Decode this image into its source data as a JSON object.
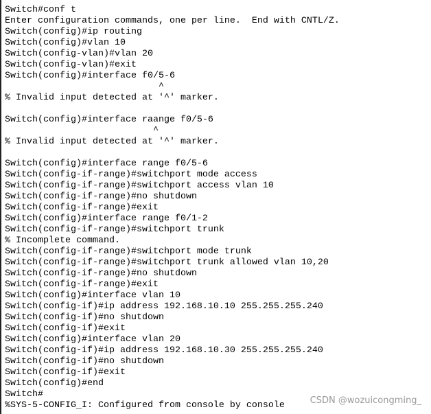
{
  "terminal": {
    "lines": [
      "Switch#conf t",
      "Enter configuration commands, one per line.  End with CNTL/Z.",
      "Switch(config)#ip routing",
      "Switch(config)#vlan 10",
      "Switch(config-vlan)#vlan 20",
      "Switch(config-vlan)#exit",
      "Switch(config)#interface f0/5-6",
      "                            ^",
      "% Invalid input detected at '^' marker.",
      "",
      "Switch(config)#interface raange f0/5-6",
      "                           ^",
      "% Invalid input detected at '^' marker.",
      "",
      "Switch(config)#interface range f0/5-6",
      "Switch(config-if-range)#switchport mode access",
      "Switch(config-if-range)#switchport access vlan 10",
      "Switch(config-if-range)#no shutdown",
      "Switch(config-if-range)#exit",
      "Switch(config)#interface range f0/1-2",
      "Switch(config-if-range)#switchport trunk",
      "% Incomplete command.",
      "Switch(config-if-range)#switchport mode trunk",
      "Switch(config-if-range)#switchport trunk allowed vlan 10,20",
      "Switch(config-if-range)#no shutdown",
      "Switch(config-if-range)#exit",
      "Switch(config)#interface vlan 10",
      "Switch(config-if)#ip address 192.168.10.10 255.255.255.240",
      "Switch(config-if)#no shutdown",
      "Switch(config-if)#exit",
      "Switch(config)#interface vlan 20",
      "Switch(config-if)#ip address 192.168.10.30 255.255.255.240",
      "Switch(config-if)#no shutdown",
      "Switch(config-if)#exit",
      "Switch(config)#end",
      "Switch#",
      "%SYS-5-CONFIG_I: Configured from console by console"
    ]
  },
  "watermark": "CSDN @wozuicongming_"
}
